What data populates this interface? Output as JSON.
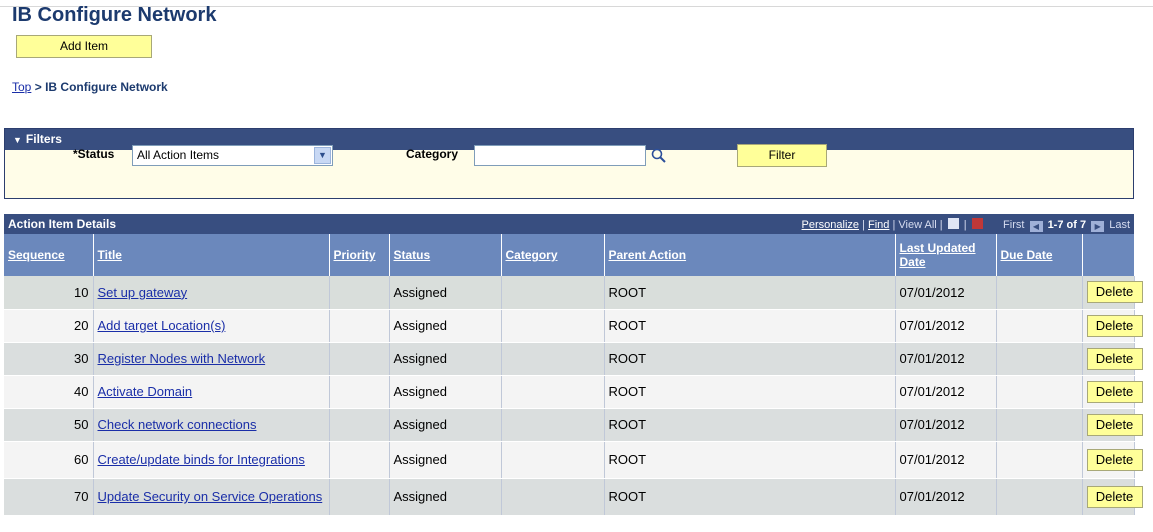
{
  "page": {
    "title": "IB Configure Network",
    "add_item_label": "Add Item"
  },
  "breadcrumb": {
    "top_label": "Top",
    "separator": ">",
    "current": "IB Configure Network"
  },
  "filters": {
    "header": "Filters",
    "status_label": "*Status",
    "status_value": "All Action Items",
    "category_label": "Category",
    "category_value": "",
    "filter_button": "Filter"
  },
  "grid": {
    "title": "Action Item Details",
    "nav": {
      "personalize": "Personalize",
      "find": "Find",
      "view_all": "View All",
      "first": "First",
      "range": "1-7 of 7",
      "last": "Last"
    },
    "columns": [
      "Sequence",
      "Title",
      "Priority",
      "Status",
      "Category",
      "Parent Action",
      "Last Updated Date",
      "Due Date"
    ],
    "delete_label": "Delete",
    "rows": [
      {
        "sequence": "10",
        "title": "Set up gateway",
        "priority": "",
        "status": "Assigned",
        "category": "",
        "parent_action": "ROOT",
        "last_updated": "07/01/2012",
        "due_date": ""
      },
      {
        "sequence": "20",
        "title": "Add target Location(s)",
        "priority": "",
        "status": "Assigned",
        "category": "",
        "parent_action": "ROOT",
        "last_updated": "07/01/2012",
        "due_date": ""
      },
      {
        "sequence": "30",
        "title": "Register Nodes with Network",
        "priority": "",
        "status": "Assigned",
        "category": "",
        "parent_action": "ROOT",
        "last_updated": "07/01/2012",
        "due_date": ""
      },
      {
        "sequence": "40",
        "title": "Activate Domain",
        "priority": "",
        "status": "Assigned",
        "category": "",
        "parent_action": "ROOT",
        "last_updated": "07/01/2012",
        "due_date": ""
      },
      {
        "sequence": "50",
        "title": "Check network connections",
        "priority": "",
        "status": "Assigned",
        "category": "",
        "parent_action": "ROOT",
        "last_updated": "07/01/2012",
        "due_date": ""
      },
      {
        "sequence": "60",
        "title": "Create/update binds for Integrations",
        "priority": "",
        "status": "Assigned",
        "category": "",
        "parent_action": "ROOT",
        "last_updated": "07/01/2012",
        "due_date": ""
      },
      {
        "sequence": "70",
        "title": "Update Security on Service Operations",
        "priority": "",
        "status": "Assigned",
        "category": "",
        "parent_action": "ROOT",
        "last_updated": "07/01/2012",
        "due_date": ""
      }
    ]
  },
  "icons": {
    "dropdown": "chevron-down-icon",
    "lookup": "magnifier-icon",
    "zoom": "zoom-icon",
    "download": "spreadsheet-icon",
    "first": "arrow-left-icon",
    "last": "arrow-right-icon"
  },
  "colors": {
    "header_bar": "#384e80",
    "column_header": "#6b88bc",
    "button_yellow": "#ffff99",
    "link": "#1a2ea8",
    "title": "#1c3a6e"
  }
}
